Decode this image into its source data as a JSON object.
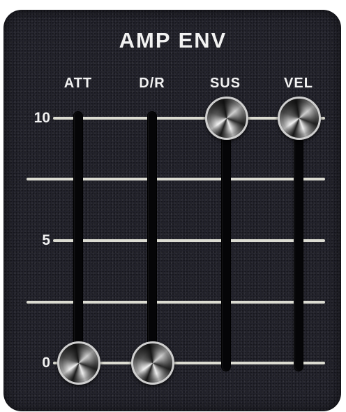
{
  "panel": {
    "title": "AMP ENV"
  },
  "scale": {
    "max_label": "10",
    "mid_label": "5",
    "min_label": "0"
  },
  "sliders": [
    {
      "label": "ATT",
      "value": 0
    },
    {
      "label": "D/R",
      "value": 0
    },
    {
      "label": "SUS",
      "value": 10
    },
    {
      "label": "VEL",
      "value": 10
    }
  ],
  "colors": {
    "panel_background": "#23232c",
    "tick_lines": "#dcdcd2",
    "text": "#f2f2f2"
  }
}
